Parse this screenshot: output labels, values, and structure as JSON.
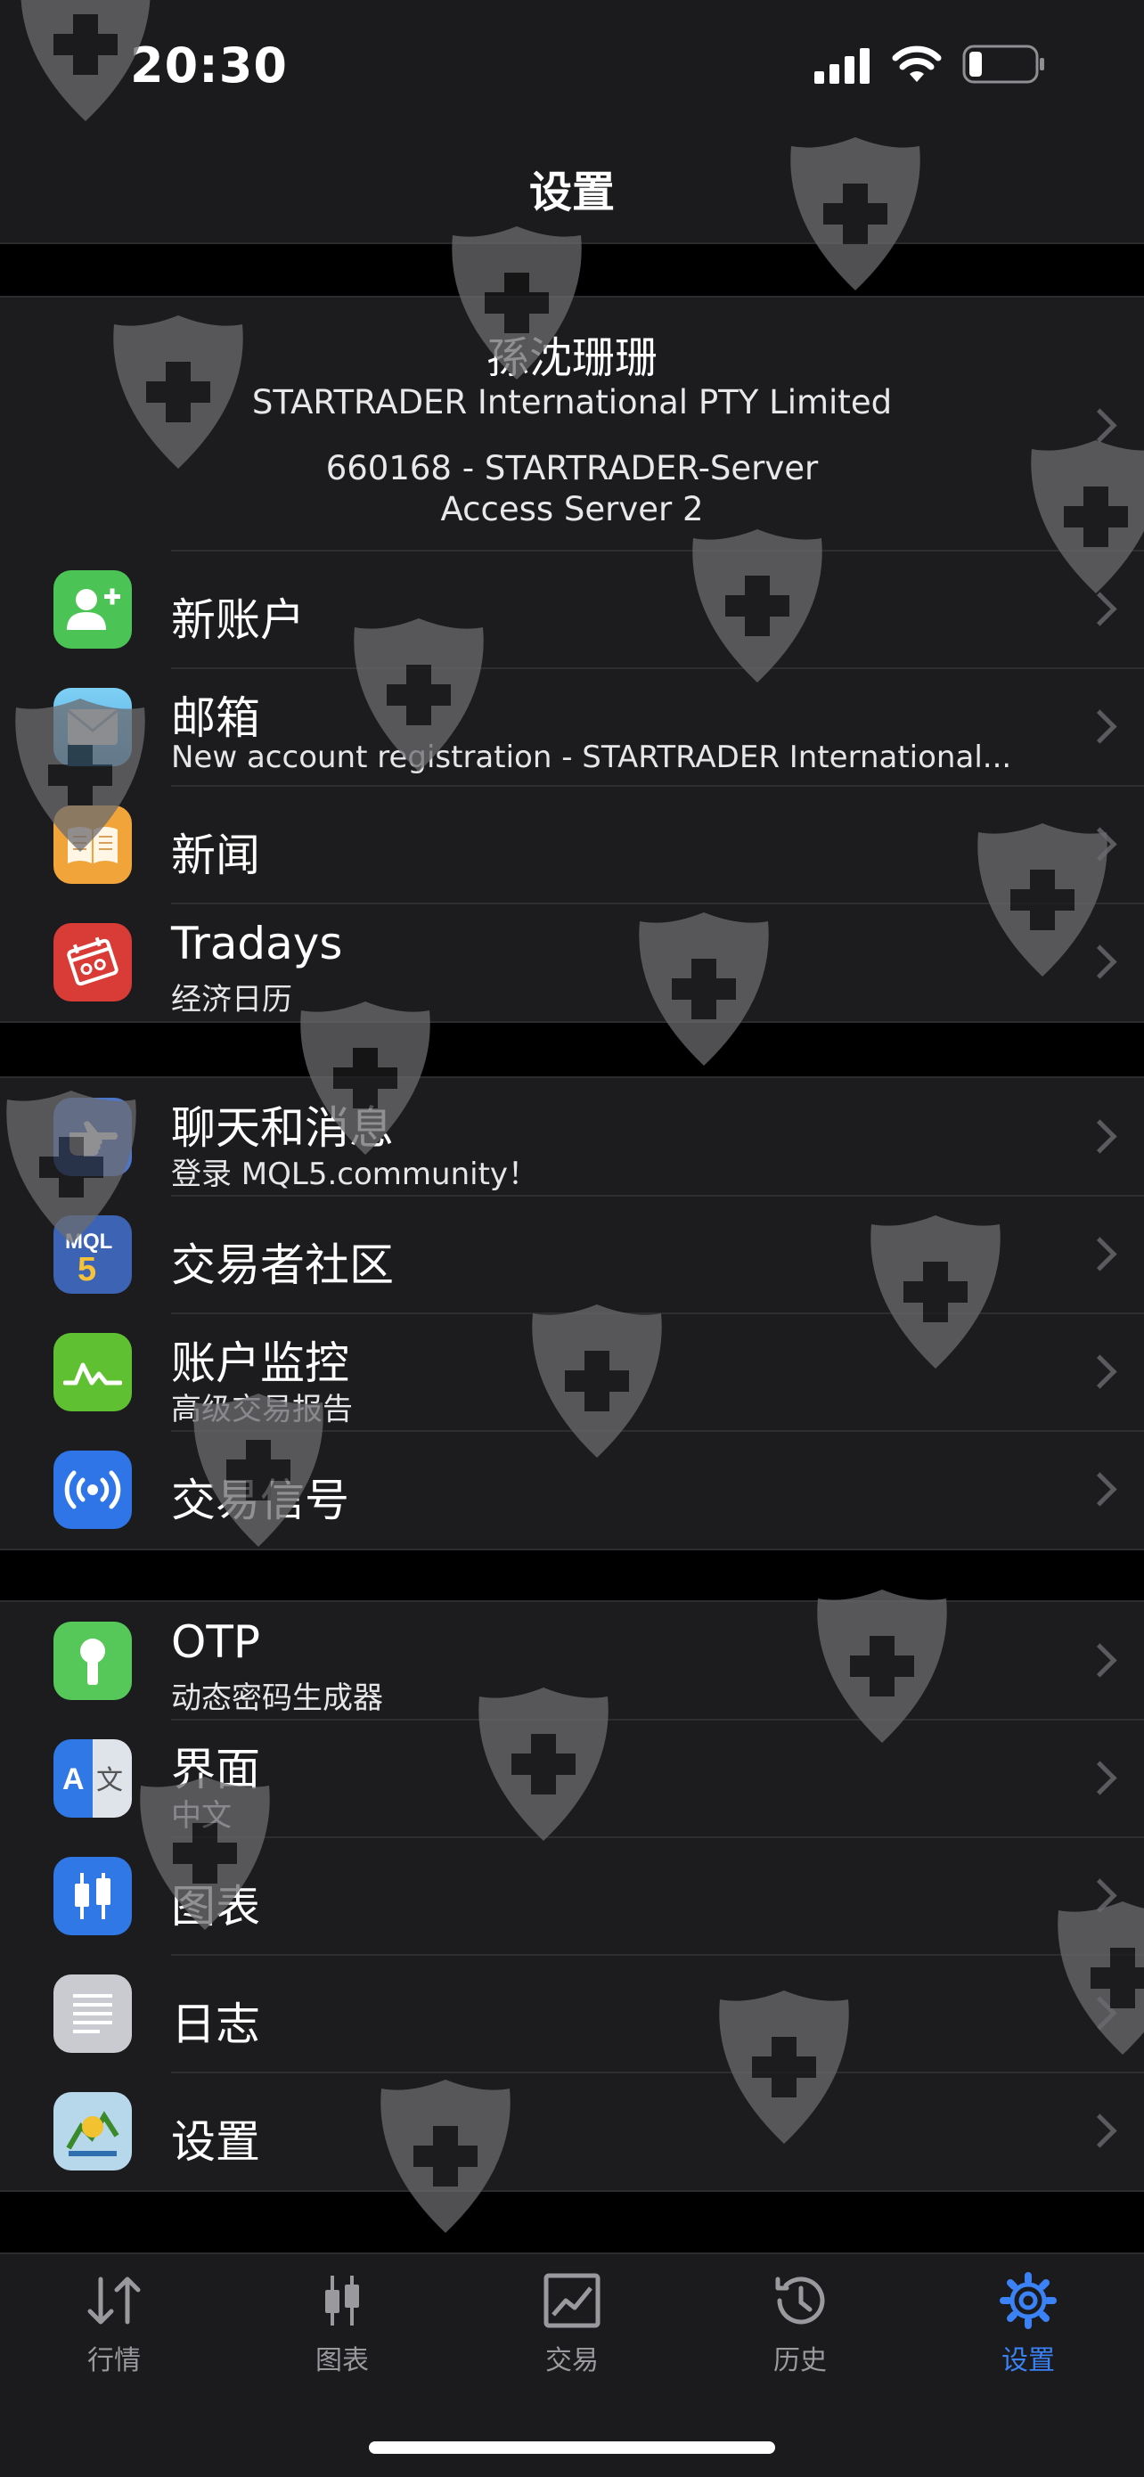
{
  "status_bar": {
    "time": "20:30"
  },
  "header": {
    "title": "设置"
  },
  "account": {
    "name": "孫沈珊珊",
    "company": "STARTRADER International PTY Limited",
    "login": "660168 - STARTRADER-Server",
    "server": "Access Server 2"
  },
  "group1": {
    "new_account": {
      "label": "新账户",
      "icon": "add-user-icon",
      "color": "#4cc355"
    },
    "mailbox": {
      "label": "邮箱",
      "sub": "New account registration - STARTRADER International...",
      "icon": "mail-icon",
      "color": "#6fc1ec"
    },
    "news": {
      "label": "新闻",
      "icon": "book-icon",
      "color": "#f0a43a"
    },
    "tradays": {
      "label": "Tradays",
      "sub": "经济日历",
      "icon": "calendar-icon",
      "color": "#d93b36"
    }
  },
  "group2": {
    "chat": {
      "label": "聊天和消息",
      "sub": "登录 MQL5.community！",
      "icon": "hand-pointer-icon",
      "color": "#4d76c9"
    },
    "community": {
      "label": "交易者社区",
      "icon": "mql5-icon",
      "color": "#3d64b4"
    },
    "monitoring": {
      "label": "账户监控",
      "sub": "高级交易报告",
      "icon": "pulse-chart-icon",
      "color": "#5fc131"
    },
    "signals": {
      "label": "交易信号",
      "icon": "broadcast-icon",
      "color": "#2f75e8"
    }
  },
  "group3": {
    "otp": {
      "label": "OTP",
      "sub": "动态密码生成器",
      "icon": "key-icon",
      "color": "#56c85a"
    },
    "interface": {
      "label": "界面",
      "sub": "中文",
      "icon": "translate-icon",
      "color": "#2f78e6"
    },
    "charts": {
      "label": "图表",
      "icon": "candlestick-icon",
      "color": "#2f78e6"
    },
    "journal": {
      "label": "日志",
      "icon": "document-lines-icon",
      "color": "#c9cbd1"
    },
    "settings": {
      "label": "设置",
      "icon": "metatrader-icon",
      "color": "#b7d7ea"
    }
  },
  "tabbar": {
    "quotes": "行情",
    "charts": "图表",
    "trade": "交易",
    "history": "历史",
    "settings": "设置",
    "active_color": "#3b82f6"
  }
}
